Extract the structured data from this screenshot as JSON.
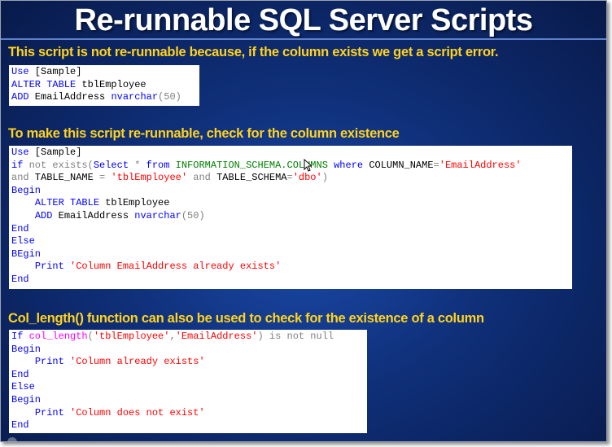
{
  "slide": {
    "title": "Re-runnable SQL Server Scripts",
    "sections": [
      {
        "heading": "This script is not re-runnable because, if the column exists we get a script error.",
        "code": [
          [
            {
              "t": "Use",
              "c": "kw"
            },
            {
              "t": " [Sample]",
              "c": "bk"
            }
          ],
          [
            {
              "t": "ALTER TABLE",
              "c": "kw"
            },
            {
              "t": " tblEmployee",
              "c": "bk"
            }
          ],
          [
            {
              "t": "ADD",
              "c": "kw"
            },
            {
              "t": " EmailAddress ",
              "c": "bk"
            },
            {
              "t": "nvarchar",
              "c": "kw"
            },
            {
              "t": "(50)",
              "c": "gy"
            }
          ]
        ]
      },
      {
        "heading": "To make this script re-runnable, check for the column existence",
        "code": [
          [
            {
              "t": "Use",
              "c": "kw"
            },
            {
              "t": " [Sample]",
              "c": "bk"
            }
          ],
          [
            {
              "t": "if",
              "c": "kw"
            },
            {
              "t": " not exists(",
              "c": "gy"
            },
            {
              "t": "Select",
              "c": "kw"
            },
            {
              "t": " * ",
              "c": "gy"
            },
            {
              "t": "from",
              "c": "kw"
            },
            {
              "t": " INFORMATION_SCHEMA.COLUMNS ",
              "c": "gr"
            },
            {
              "t": "where",
              "c": "kw"
            },
            {
              "t": " COLUMN_NAME",
              "c": "bk"
            },
            {
              "t": "=",
              "c": "gy"
            },
            {
              "t": "'EmailAddress'",
              "c": "rd"
            }
          ],
          [
            {
              "t": "and",
              "c": "gy"
            },
            {
              "t": " TABLE_NAME ",
              "c": "bk"
            },
            {
              "t": "=",
              "c": "gy"
            },
            {
              "t": " ",
              "c": "bk"
            },
            {
              "t": "'tblEmployee'",
              "c": "rd"
            },
            {
              "t": " ",
              "c": "bk"
            },
            {
              "t": "and",
              "c": "gy"
            },
            {
              "t": " TABLE_SCHEMA",
              "c": "bk"
            },
            {
              "t": "=",
              "c": "gy"
            },
            {
              "t": "'dbo'",
              "c": "rd"
            },
            {
              "t": ")",
              "c": "gy"
            }
          ],
          [
            {
              "t": "Begin",
              "c": "kw"
            }
          ],
          [
            {
              "t": "    ",
              "c": "bk"
            },
            {
              "t": "ALTER TABLE",
              "c": "kw"
            },
            {
              "t": " tblEmployee",
              "c": "bk"
            }
          ],
          [
            {
              "t": "    ",
              "c": "bk"
            },
            {
              "t": "ADD",
              "c": "kw"
            },
            {
              "t": " EmailAddress ",
              "c": "bk"
            },
            {
              "t": "nvarchar",
              "c": "kw"
            },
            {
              "t": "(50)",
              "c": "gy"
            }
          ],
          [
            {
              "t": "End",
              "c": "kw"
            }
          ],
          [
            {
              "t": "Else",
              "c": "kw"
            }
          ],
          [
            {
              "t": "BEgin",
              "c": "kw"
            }
          ],
          [
            {
              "t": "    ",
              "c": "bk"
            },
            {
              "t": "Print",
              "c": "kw"
            },
            {
              "t": " ",
              "c": "bk"
            },
            {
              "t": "'Column EmailAddress already exists'",
              "c": "rd"
            }
          ],
          [
            {
              "t": "End",
              "c": "kw"
            }
          ]
        ]
      },
      {
        "heading": "Col_length() function can also be used to check for the existence of a column",
        "code": [
          [
            {
              "t": "If",
              "c": "kw"
            },
            {
              "t": " ",
              "c": "bk"
            },
            {
              "t": "col_length",
              "c": "mg"
            },
            {
              "t": "(",
              "c": "gy"
            },
            {
              "t": "'tblEmployee'",
              "c": "rd"
            },
            {
              "t": ",",
              "c": "gy"
            },
            {
              "t": "'EmailAddress'",
              "c": "rd"
            },
            {
              "t": ") is not null",
              "c": "gy"
            }
          ],
          [
            {
              "t": "Begin",
              "c": "kw"
            }
          ],
          [
            {
              "t": "    ",
              "c": "bk"
            },
            {
              "t": "Print",
              "c": "kw"
            },
            {
              "t": " ",
              "c": "bk"
            },
            {
              "t": "'Column already exists'",
              "c": "rd"
            }
          ],
          [
            {
              "t": "End",
              "c": "kw"
            }
          ],
          [
            {
              "t": "Else",
              "c": "kw"
            }
          ],
          [
            {
              "t": "Begin",
              "c": "kw"
            }
          ],
          [
            {
              "t": "    ",
              "c": "bk"
            },
            {
              "t": "Print",
              "c": "kw"
            },
            {
              "t": " ",
              "c": "bk"
            },
            {
              "t": "'Column does not exist'",
              "c": "rd"
            }
          ],
          [
            {
              "t": "End",
              "c": "kw"
            }
          ]
        ]
      }
    ]
  },
  "colors": {
    "keyword": "#0000ff",
    "operator": "#808080",
    "string": "#ff0000",
    "system_view": "#008000",
    "function": "#ff00ff",
    "heading": "#ffd21e",
    "background": "#0f2f78"
  },
  "icons": {
    "cursor": "mouse-pointer-icon"
  }
}
